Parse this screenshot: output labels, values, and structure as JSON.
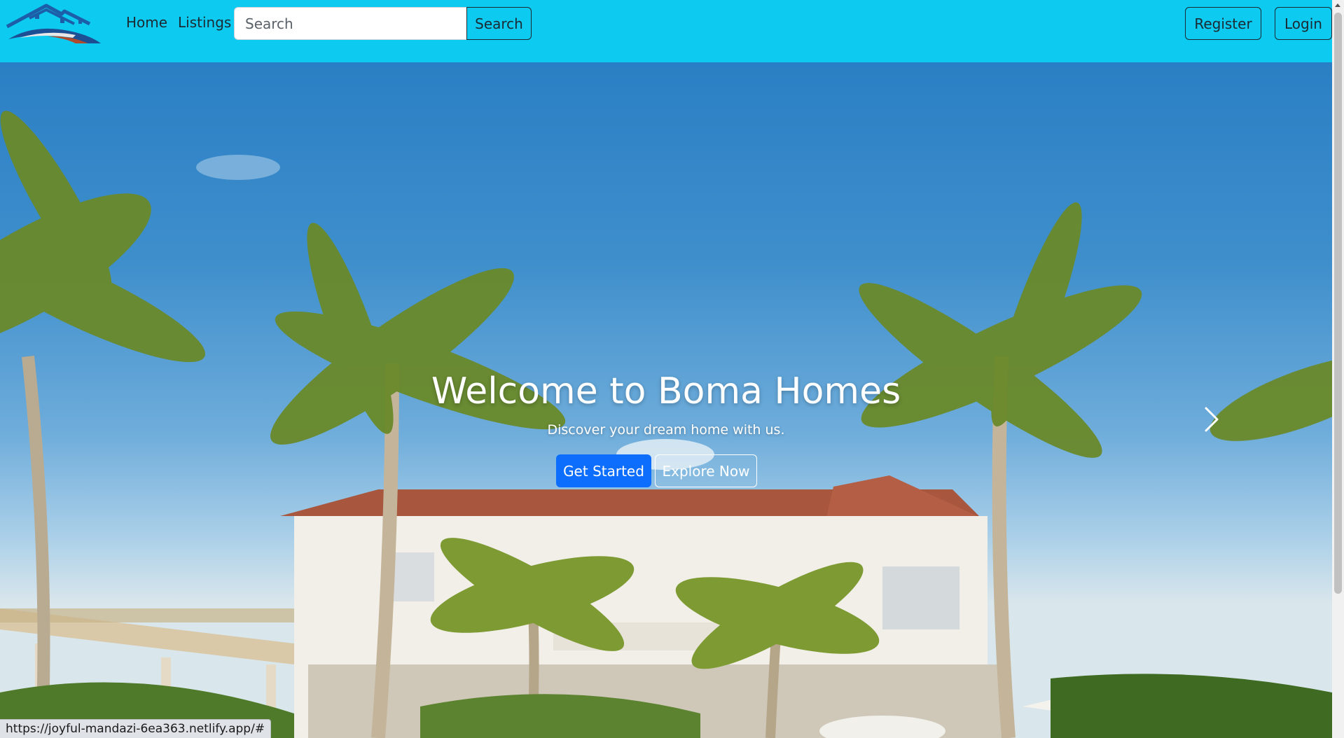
{
  "brand": {
    "logo_icon": "house-roof-logo-icon"
  },
  "nav": {
    "home": "Home",
    "listings": "Listings"
  },
  "search": {
    "placeholder": "Search",
    "value": "",
    "button": "Search"
  },
  "auth": {
    "register": "Register",
    "login": "Login"
  },
  "hero": {
    "title": "Welcome to Boma Homes",
    "subtitle": "Discover your dream home with us.",
    "primary_button": "Get Started",
    "secondary_button": "Explore Now",
    "next_icon": "chevron-right-icon",
    "prev_icon": "chevron-left-icon"
  },
  "status_bar": {
    "url": "https://joyful-mandazi-6ea363.netlify.app/#"
  },
  "colors": {
    "navbar": "#0dcaf0",
    "primary": "#0d6efd",
    "text_dark": "#1b2a33"
  }
}
